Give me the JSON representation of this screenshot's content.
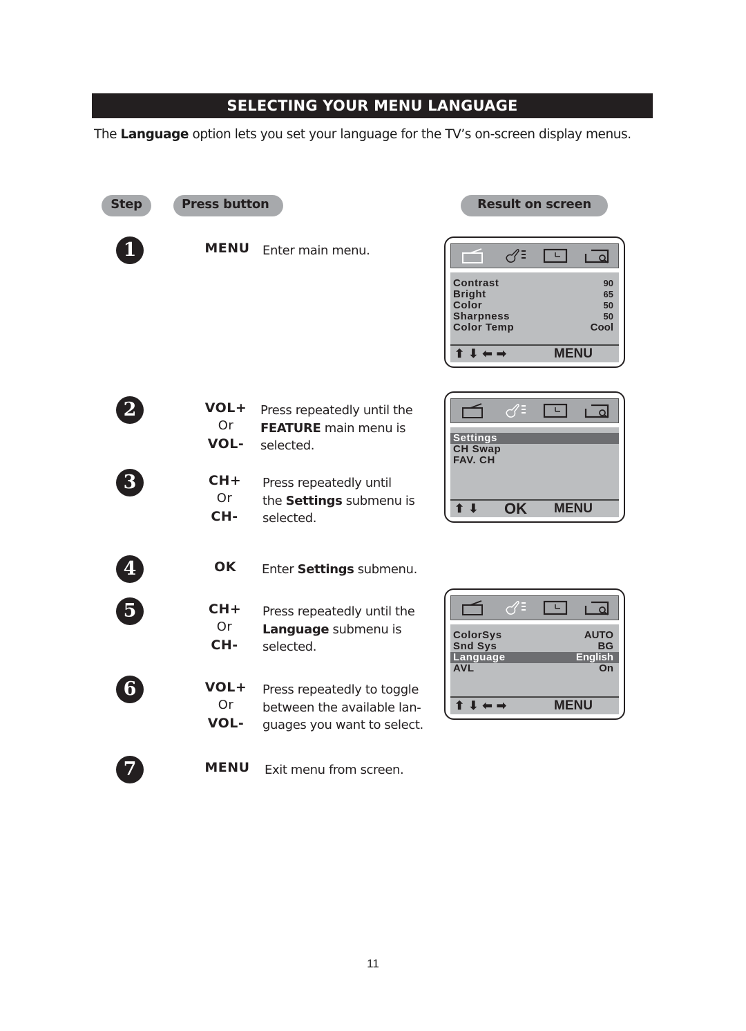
{
  "title": "SELECTING YOUR MENU LANGUAGE",
  "intro": {
    "pre": "The ",
    "bold": "Language",
    "post": " option lets you set your language for the TV’s on-screen display menus."
  },
  "headers": {
    "step": "Step",
    "press": "Press button",
    "result": "Result on screen"
  },
  "steps": [
    {
      "num": "1",
      "buttons": [
        "MENU"
      ],
      "desc": [
        {
          "t": "Enter main menu."
        }
      ]
    },
    {
      "num": "2",
      "buttons": [
        "VOL+",
        "Or",
        "VOL-"
      ],
      "desc_lines": [
        "Press repeatedly until the",
        "FEATURE| main menu is",
        "selected."
      ]
    },
    {
      "num": "3",
      "buttons": [
        "CH+",
        "Or",
        "CH-"
      ],
      "desc_lines": [
        "Press repeatedly until",
        "the |Settings| submenu is",
        "selected."
      ]
    },
    {
      "num": "4",
      "buttons": [
        "OK"
      ],
      "desc_lines": [
        "Enter |Settings| submenu."
      ]
    },
    {
      "num": "5",
      "buttons": [
        "CH+",
        "Or",
        "CH-"
      ],
      "desc_lines": [
        "Press repeatedly until the",
        "Language| submenu is",
        "selected."
      ]
    },
    {
      "num": "6",
      "buttons": [
        "VOL+",
        "Or",
        "VOL-"
      ],
      "desc_lines": [
        "Press repeatedly to toggle",
        "between the available lan-",
        "guages you want to select."
      ]
    },
    {
      "num": "7",
      "buttons": [
        "MENU"
      ],
      "desc_lines": [
        "Exit menu from screen."
      ]
    }
  ],
  "screens": [
    {
      "rows": [
        [
          "Contrast",
          "90"
        ],
        [
          "Bright",
          "65"
        ],
        [
          "Color",
          "50"
        ],
        [
          "Sharpness",
          "50"
        ],
        [
          "Color Temp",
          "Cool"
        ]
      ],
      "selected": -1,
      "footer_arrows": "⬆⬇⬅➡",
      "footer_ok": "",
      "footer_menu": "MENU",
      "active_icon": "picture"
    },
    {
      "rows": [
        [
          "Settings",
          ""
        ],
        [
          "CH Swap",
          ""
        ],
        [
          "FAV. CH",
          ""
        ]
      ],
      "selected": 0,
      "footer_arrows": "⬆⬇",
      "footer_ok": "OK",
      "footer_menu": "MENU",
      "active_icon": "feature"
    },
    {
      "rows": [
        [
          "ColorSys",
          "AUTO"
        ],
        [
          "Snd Sys",
          "BG"
        ],
        [
          "Language",
          "English"
        ],
        [
          "AVL",
          "On"
        ]
      ],
      "selected": 2,
      "footer_arrows": "⬆⬇⬅➡",
      "footer_ok": "",
      "footer_menu": "MENU",
      "active_icon": "feature"
    }
  ],
  "page_number": "11"
}
